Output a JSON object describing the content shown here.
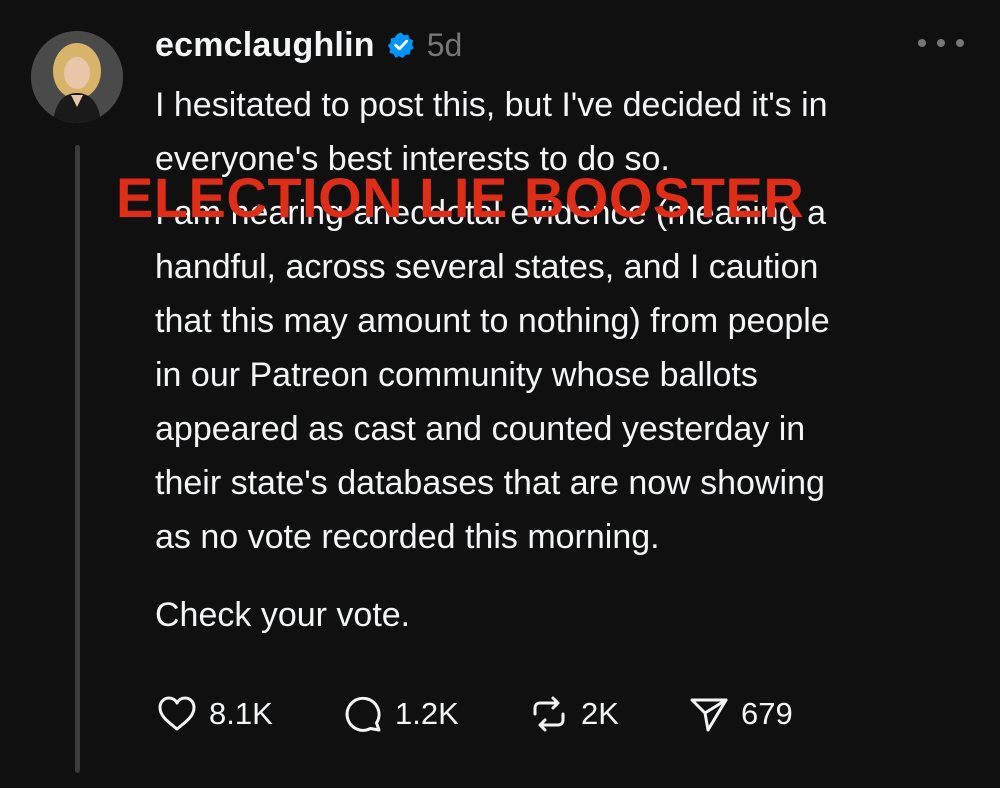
{
  "post": {
    "username": "ecmclaughlin",
    "verified": true,
    "timestamp": "5d",
    "body_lines": [
      "I hesitated to post this, but I've decided it's in",
      "everyone's best interests to do so.",
      "I am hearing anecdotal evidence (meaning a",
      "handful, across several states, and I caution",
      "that this may amount to nothing) from people",
      "in our Patreon community whose ballots",
      "appeared as cast and counted yesterday in",
      "their state's databases that are now showing",
      "as no vote recorded this morning."
    ],
    "closing_line": "Check your vote.",
    "overlay_label": "ELECTION LIE BOOSTER"
  },
  "actions": {
    "likes": "8.1K",
    "replies": "1.2K",
    "reposts": "2K",
    "shares": "679"
  },
  "icons": {
    "verified": "verified-badge-icon",
    "more": "more-options-icon",
    "like": "heart-icon",
    "reply": "comment-bubble-icon",
    "repost": "repost-icon",
    "share": "send-icon"
  },
  "colors": {
    "background": "#101010",
    "text": "#f3f5f7",
    "muted": "#777777",
    "verified": "#0095f6",
    "overlay": "#e02d18",
    "thread_line": "#3b3b3b"
  }
}
